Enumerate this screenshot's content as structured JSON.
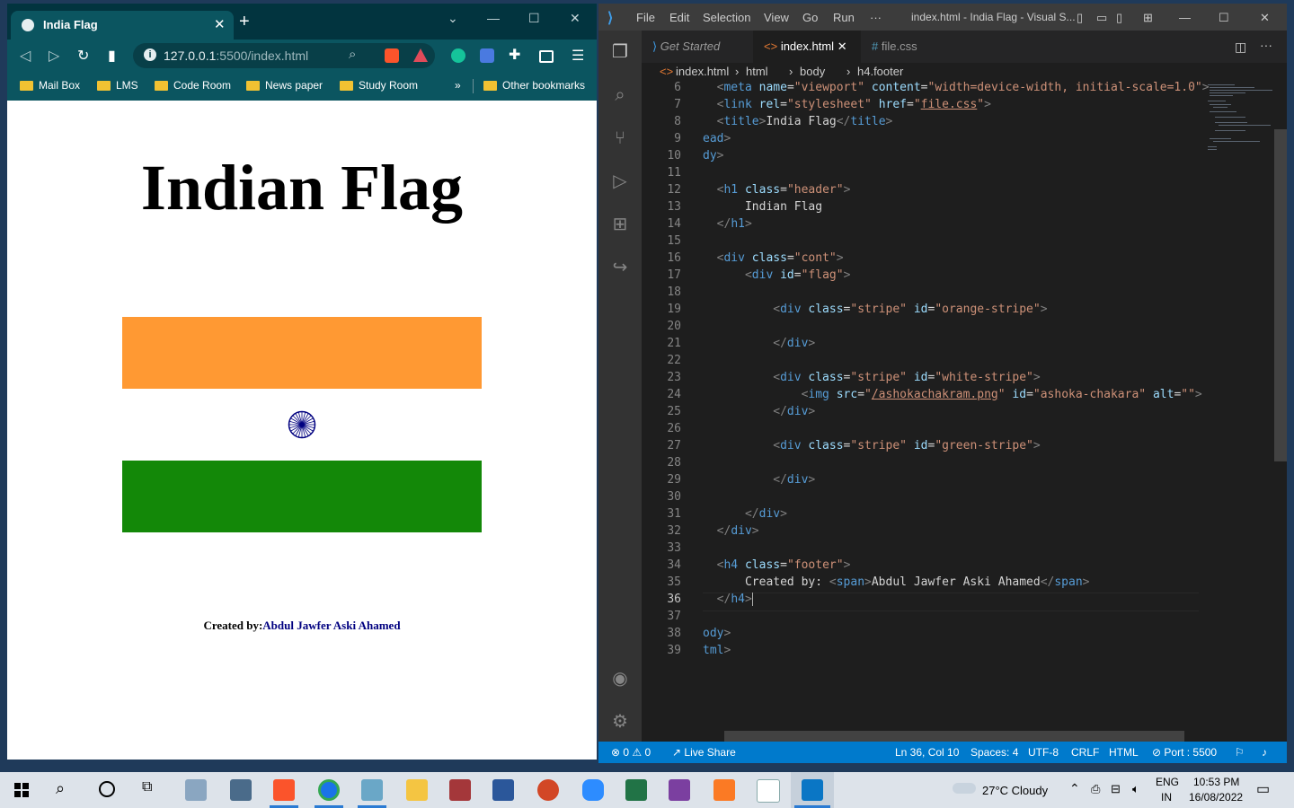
{
  "browser": {
    "tab_title": "India Flag",
    "url_host": "127.0.0.1",
    "url_path": ":5500/index.html",
    "bookmarks": [
      "Mail Box",
      "LMS",
      "Code Room",
      "News paper",
      "Study Room"
    ],
    "more": "»",
    "other_bookmarks": "Other bookmarks",
    "page": {
      "heading": "Indian Flag",
      "footer_label": "Created by:",
      "footer_name": "Abdul Jawfer Aski Ahamed",
      "flag_colors": {
        "orange": "#ff9933",
        "white": "#ffffff",
        "green": "#138808",
        "chakra": "#000080"
      }
    }
  },
  "vscode": {
    "menu": [
      "File",
      "Edit",
      "Selection",
      "View",
      "Go",
      "Run",
      "···"
    ],
    "window_title": "index.html - India Flag - Visual S...",
    "tabs": [
      {
        "label": "Get Started"
      },
      {
        "label": "index.html"
      },
      {
        "label": "file.css"
      }
    ],
    "breadcrumb": [
      "index.html",
      "html",
      "body",
      "h4.footer"
    ],
    "line_numbers": [
      "6",
      "7",
      "8",
      "9",
      "10",
      "11",
      "12",
      "13",
      "14",
      "15",
      "16",
      "17",
      "18",
      "19",
      "20",
      "21",
      "22",
      "23",
      "24",
      "25",
      "26",
      "27",
      "28",
      "29",
      "30",
      "31",
      "32",
      "33",
      "34",
      "35",
      "36",
      "37",
      "38",
      "39"
    ],
    "status": {
      "errors": "0",
      "warnings": "0",
      "live_share": "Live Share",
      "position": "Ln 36, Col 10",
      "spaces": "Spaces: 4",
      "encoding": "UTF-8",
      "eol": "CRLF",
      "language": "HTML",
      "port": "Port : 5500"
    }
  },
  "taskbar": {
    "weather": "27°C  Cloudy",
    "lang_top": "ENG",
    "lang_bottom": "IN",
    "time": "10:53 PM",
    "date": "16/08/2022"
  }
}
